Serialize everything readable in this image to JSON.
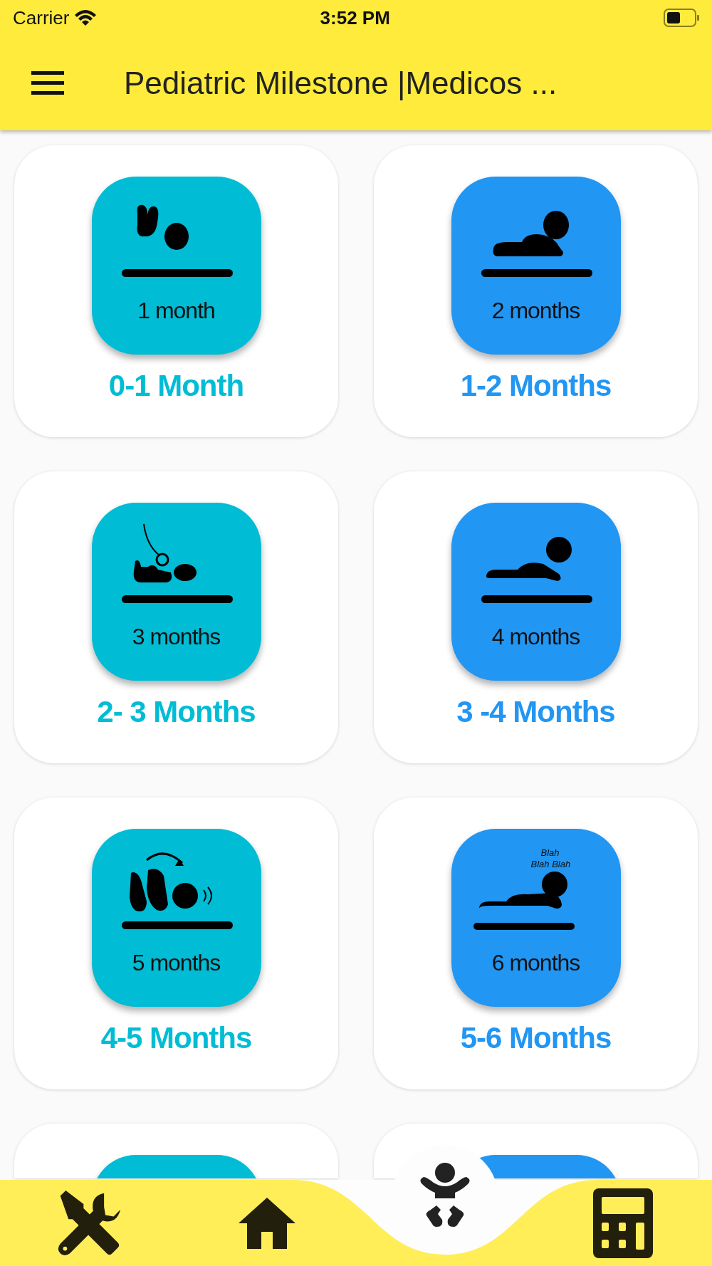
{
  "status_bar": {
    "carrier": "Carrier",
    "time": "3:52 PM"
  },
  "app_bar": {
    "title": "Pediatric Milestone |Medicos ..."
  },
  "cards": [
    {
      "label": "0-1 Month",
      "caption": "1 month",
      "color": "#00bcd4"
    },
    {
      "label": "1-2 Months",
      "caption": "2 months",
      "color": "#2196f3"
    },
    {
      "label": "2- 3 Months",
      "caption": "3 months",
      "color": "#00bcd4"
    },
    {
      "label": "3 -4 Months",
      "caption": "4 months",
      "color": "#2196f3"
    },
    {
      "label": "4-5 Months",
      "caption": "5 months",
      "color": "#00bcd4"
    },
    {
      "label": "5-6 Months",
      "caption": "6 months",
      "color": "#2196f3",
      "speech": true
    },
    {
      "color": "#00bcd4"
    },
    {
      "color": "#2196f3"
    }
  ],
  "speech_text": [
    "Blah",
    "Blah Blah"
  ],
  "bottom_nav": [
    {
      "kind": "tools",
      "selected": false
    },
    {
      "kind": "home",
      "selected": false
    },
    {
      "kind": "baby",
      "selected": true
    },
    {
      "kind": "calculator",
      "selected": false
    }
  ]
}
